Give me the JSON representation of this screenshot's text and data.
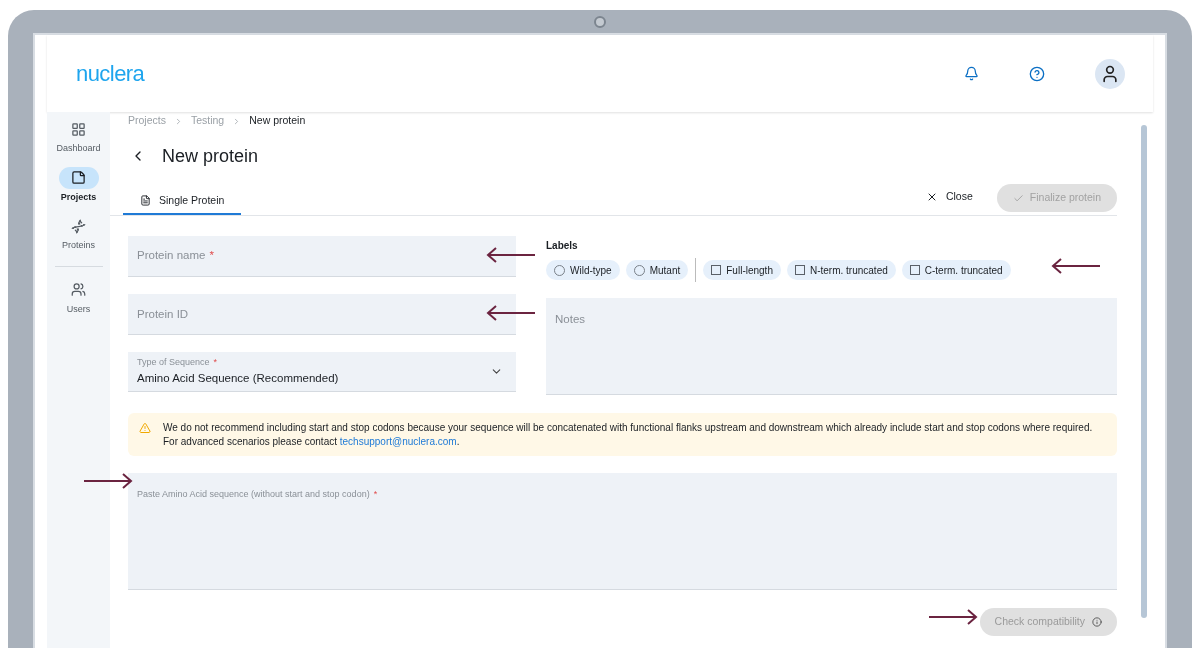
{
  "header": {
    "logo": "nuclera"
  },
  "sidebar": {
    "items": [
      {
        "kind": "dashboard",
        "label": "Dashboard",
        "selected": false
      },
      {
        "kind": "projects",
        "label": "Projects",
        "selected": true
      },
      {
        "kind": "proteins",
        "label": "Proteins",
        "selected": false
      },
      {
        "kind": "users",
        "label": "Users",
        "selected": false
      }
    ]
  },
  "breadcrumbs": [
    {
      "label": "Projects",
      "current": false
    },
    {
      "label": "Testing",
      "current": false
    },
    {
      "label": "New protein",
      "current": true
    }
  ],
  "title": "New protein",
  "tabs": [
    {
      "label": "Single Protein",
      "selected": true
    }
  ],
  "actions": {
    "close": "Close",
    "finalize": {
      "label": "Finalize protein",
      "disabled": true
    }
  },
  "fields": {
    "protein_name": {
      "placeholder": "Protein name",
      "required_mark": "*"
    },
    "protein_id": {
      "placeholder": "Protein ID"
    },
    "sequence_type": {
      "label": "Type of Sequence",
      "required_mark": "*",
      "value": "Amino Acid Sequence (Recommended)"
    },
    "notes": {
      "placeholder": "Notes"
    },
    "sequence": {
      "label": "Paste Amino Acid sequence (without start and stop codon)",
      "required_mark": "*"
    }
  },
  "labels": {
    "title": "Labels",
    "options": [
      {
        "kind": "radio",
        "label": "Wild-type",
        "checked": false
      },
      {
        "kind": "radio",
        "label": "Mutant",
        "checked": false
      },
      {
        "kind": "checkbox",
        "label": "Full-length",
        "checked": false
      },
      {
        "kind": "checkbox",
        "label": "N-term. truncated",
        "checked": false
      },
      {
        "kind": "checkbox",
        "label": "C-term. truncated",
        "checked": false
      }
    ]
  },
  "warning": {
    "text": "We do not recommend including start and stop codons because your sequence will be concatenated with functional flanks upstream and downstream which already include start and stop codons where required. For advanced scenarios please contact ",
    "link": "techsupport@nuclera.com",
    "text_end": "."
  },
  "check_button": {
    "label": "Check compatibility",
    "disabled": true
  }
}
